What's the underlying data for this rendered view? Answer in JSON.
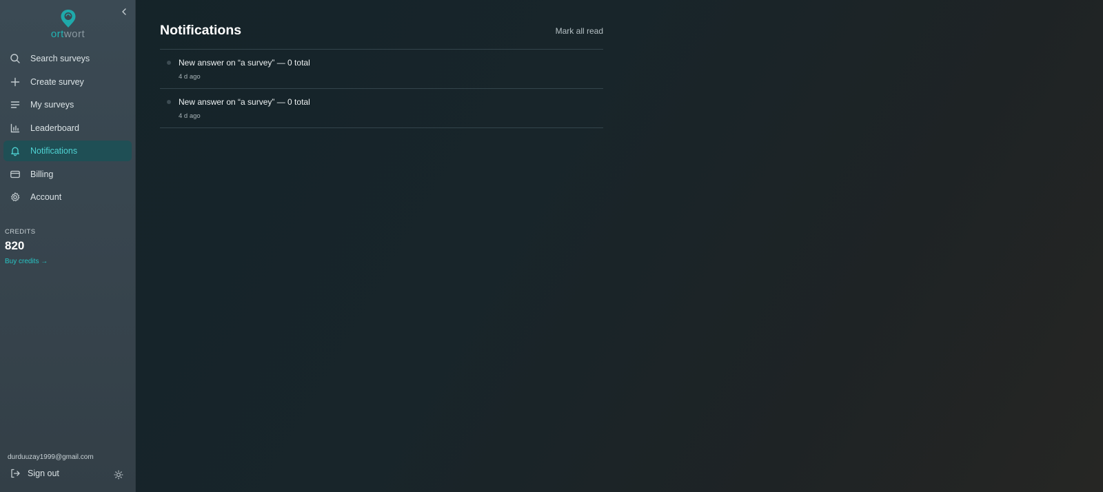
{
  "brand": {
    "logo_part1": "ort",
    "logo_part2": "wort",
    "accent_color": "#21b4b4"
  },
  "sidebar": {
    "collapse_icon": "chevron-left-icon",
    "items": [
      {
        "label": "Search surveys",
        "icon": "search-icon",
        "active": false
      },
      {
        "label": "Create survey",
        "icon": "plus-icon",
        "active": false
      },
      {
        "label": "My surveys",
        "icon": "list-icon",
        "active": false
      },
      {
        "label": "Leaderboard",
        "icon": "bar-chart-icon",
        "active": false
      },
      {
        "label": "Notifications",
        "icon": "bell-icon",
        "active": true
      },
      {
        "label": "Billing",
        "icon": "credit-card-icon",
        "active": false
      },
      {
        "label": "Account",
        "icon": "gear-icon",
        "active": false
      }
    ],
    "credits": {
      "label": "CREDITS",
      "value": "820",
      "buy_link": "Buy credits →"
    },
    "user_email": "durduuzay1999@gmail.com",
    "sign_out": "Sign out",
    "theme_toggle_icon": "sun-icon"
  },
  "main": {
    "title": "Notifications",
    "mark_all_read": "Mark all read",
    "notifications": [
      {
        "message": "New answer on “a survey” — 0 total",
        "time": "4 d ago"
      },
      {
        "message": "New answer on “a survey” — 0 total",
        "time": "4 d ago"
      }
    ]
  }
}
